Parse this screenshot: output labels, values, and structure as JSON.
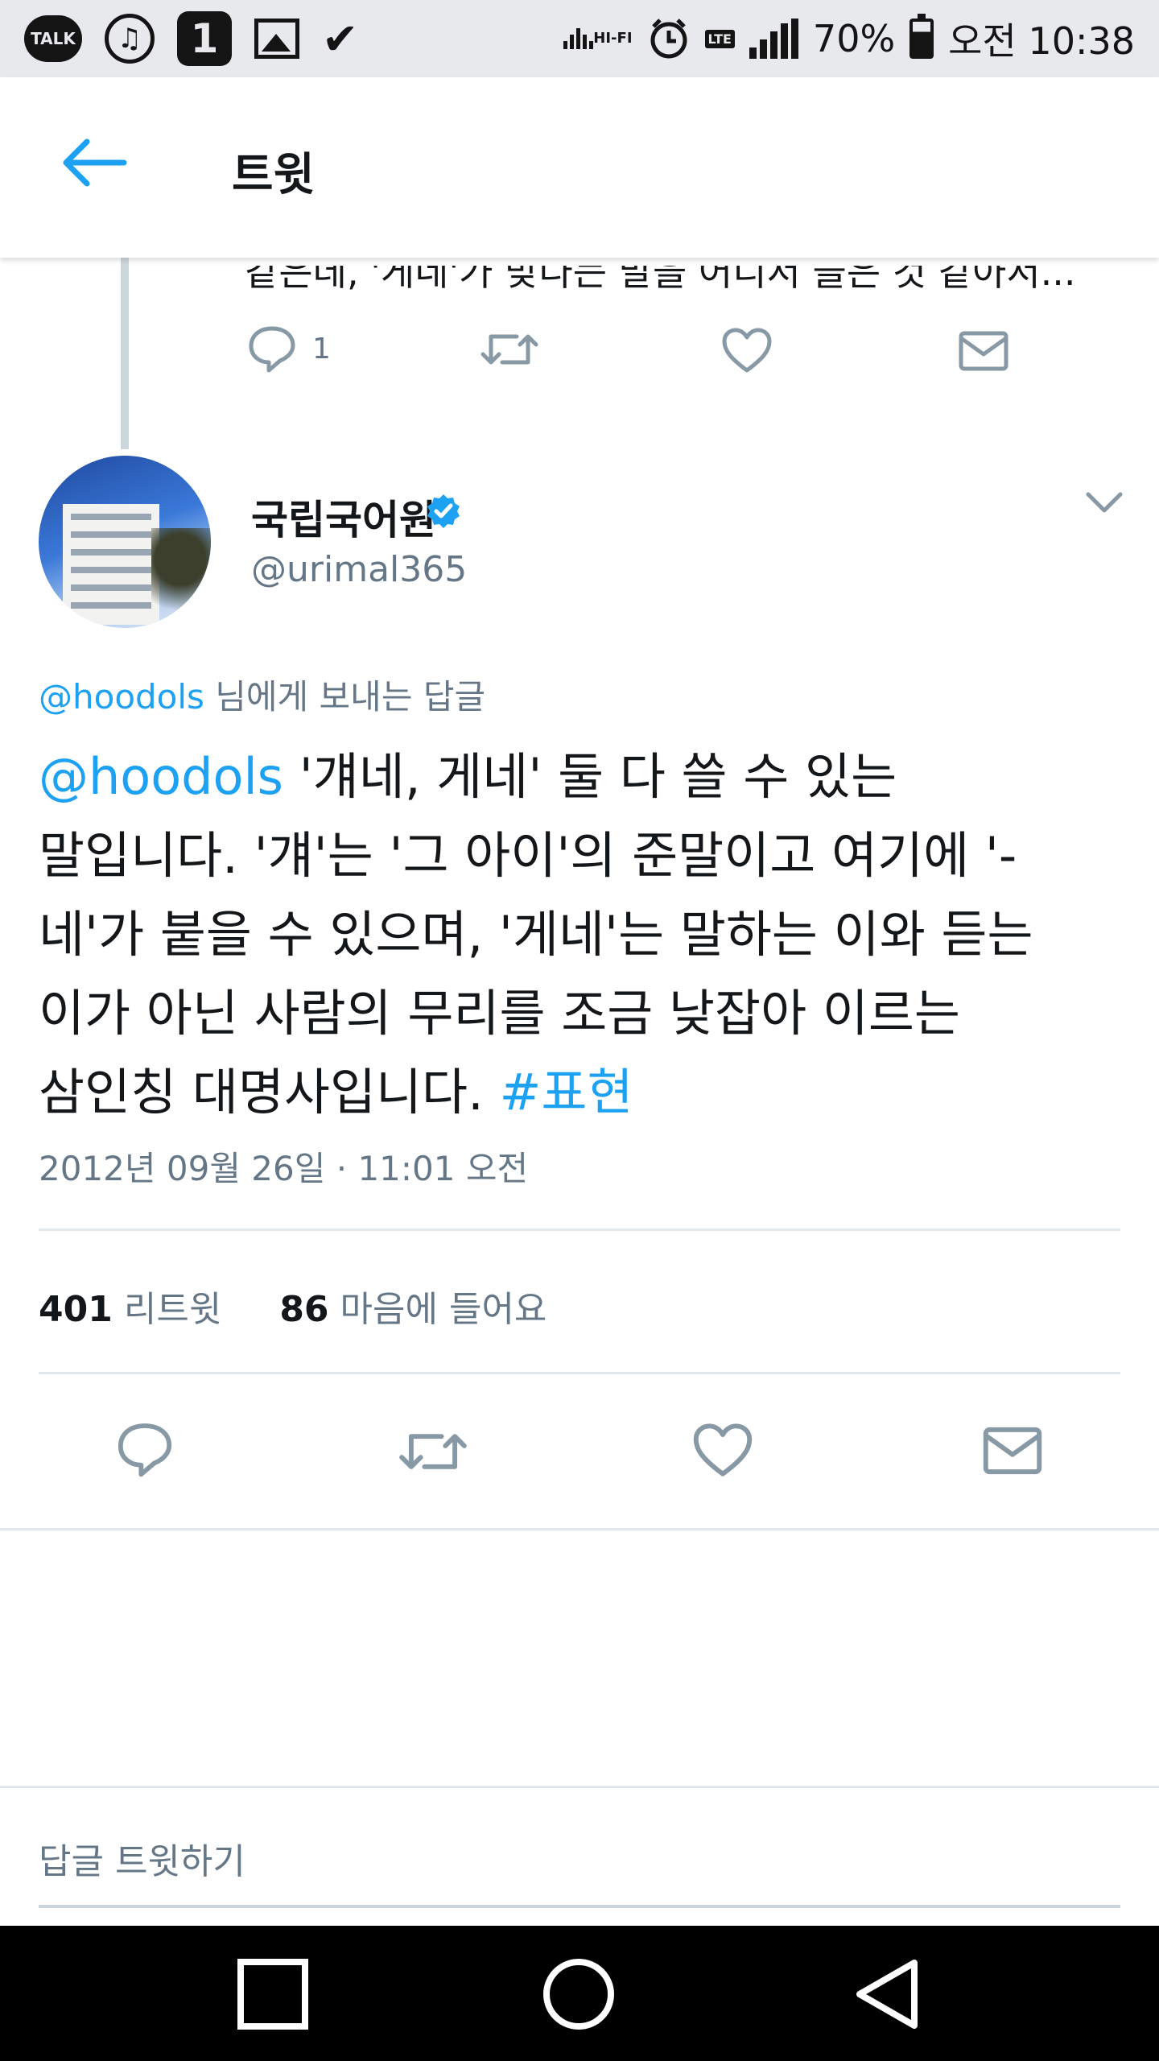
{
  "status_bar": {
    "talk_label": "TALK",
    "music_glyph": "♫",
    "notif_one": "1",
    "hifi_label": "HI-FI",
    "lte_label": "LTE",
    "battery_percent": "70%",
    "time": "오전 10:38",
    "icons": [
      "talk-icon",
      "music-icon",
      "one-icon",
      "image-icon",
      "check-icon",
      "hifi-icon",
      "alarm-icon",
      "lte-icon",
      "signal-icon",
      "battery-icon"
    ]
  },
  "appbar": {
    "title": "트윗",
    "back_icon": "back-arrow-icon"
  },
  "previous_tweet": {
    "text_fragment": "같은데, '게네'가 맞다는 말을 어디서 들은 것 같아서...",
    "reply_count": "1"
  },
  "tweet": {
    "display_name": "국립국어원",
    "handle": "@urimal365",
    "verified": true,
    "reply_to_prefix": "@hoodols",
    "reply_to_suffix": " 님에게 보내는 답글",
    "body_mention": "@hoodols",
    "body_line1": " '걔네, 게네' 둘 다 쓸 수 있는",
    "body_line2": "말입니다. '걔'는 '그 아이'의 준말이고 여기에 '-",
    "body_line3": "네'가 붙을 수 있으며, '게네'는  말하는 이와 듣는",
    "body_line4": "이가 아닌 사람의 무리를 조금 낮잡아 이르는",
    "body_line5": "삼인칭 대명사입니다. ",
    "hashtag": "#표현",
    "timestamp": "2012년 09월 26일 · 11:01 오전",
    "retweet_count": "401",
    "retweet_label": "리트윗",
    "like_count": "86",
    "like_label": "마음에 들어요"
  },
  "reply_box": {
    "placeholder": "답글 트윗하기"
  },
  "colors": {
    "accent": "#1da1f2",
    "text_primary": "#14171a",
    "text_secondary": "#657786",
    "divider": "#e1e8ed",
    "status_bar_bg": "#e7e9ec",
    "nav_bar_bg": "#000000"
  }
}
